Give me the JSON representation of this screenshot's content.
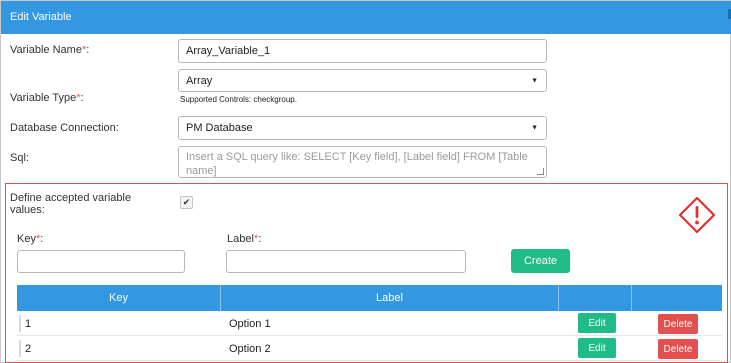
{
  "window": {
    "title": "Edit Variable"
  },
  "form": {
    "variable_name": {
      "label": "Variable Name",
      "required_mark": "*",
      "suffix": ":",
      "value": "Array_Variable_1"
    },
    "variable_type": {
      "label": "Variable Type",
      "required_mark": "*",
      "suffix": ":",
      "value": "Array",
      "hint": "Supported Controls: checkgroup."
    },
    "database_connection": {
      "label": "Database Connection:",
      "value": "PM Database"
    },
    "sql": {
      "label": "Sql:",
      "placeholder": "Insert a SQL query like: SELECT [Key field], [Label field] FROM [Table name]"
    }
  },
  "accepted_values": {
    "label": "Define accepted variable values:",
    "checked": true,
    "checkmark": "✔",
    "key_label": "Key",
    "key_required": "*",
    "key_suffix": ":",
    "label_label": "Label",
    "label_required": "*",
    "label_suffix": ":",
    "create_button": "Create",
    "warning_icon": "warning-diamond-icon"
  },
  "grid": {
    "columns": [
      "Key",
      "Label",
      "",
      ""
    ],
    "rows": [
      {
        "key": "1",
        "label": "Option 1",
        "edit": "Edit",
        "delete": "Delete"
      },
      {
        "key": "2",
        "label": "Option 2",
        "edit": "Edit",
        "delete": "Delete"
      }
    ]
  },
  "colors": {
    "header_blue": "#3397e1",
    "create_green": "#1fbc87",
    "delete_red": "#e3504e",
    "warning_red": "#d9534f"
  }
}
